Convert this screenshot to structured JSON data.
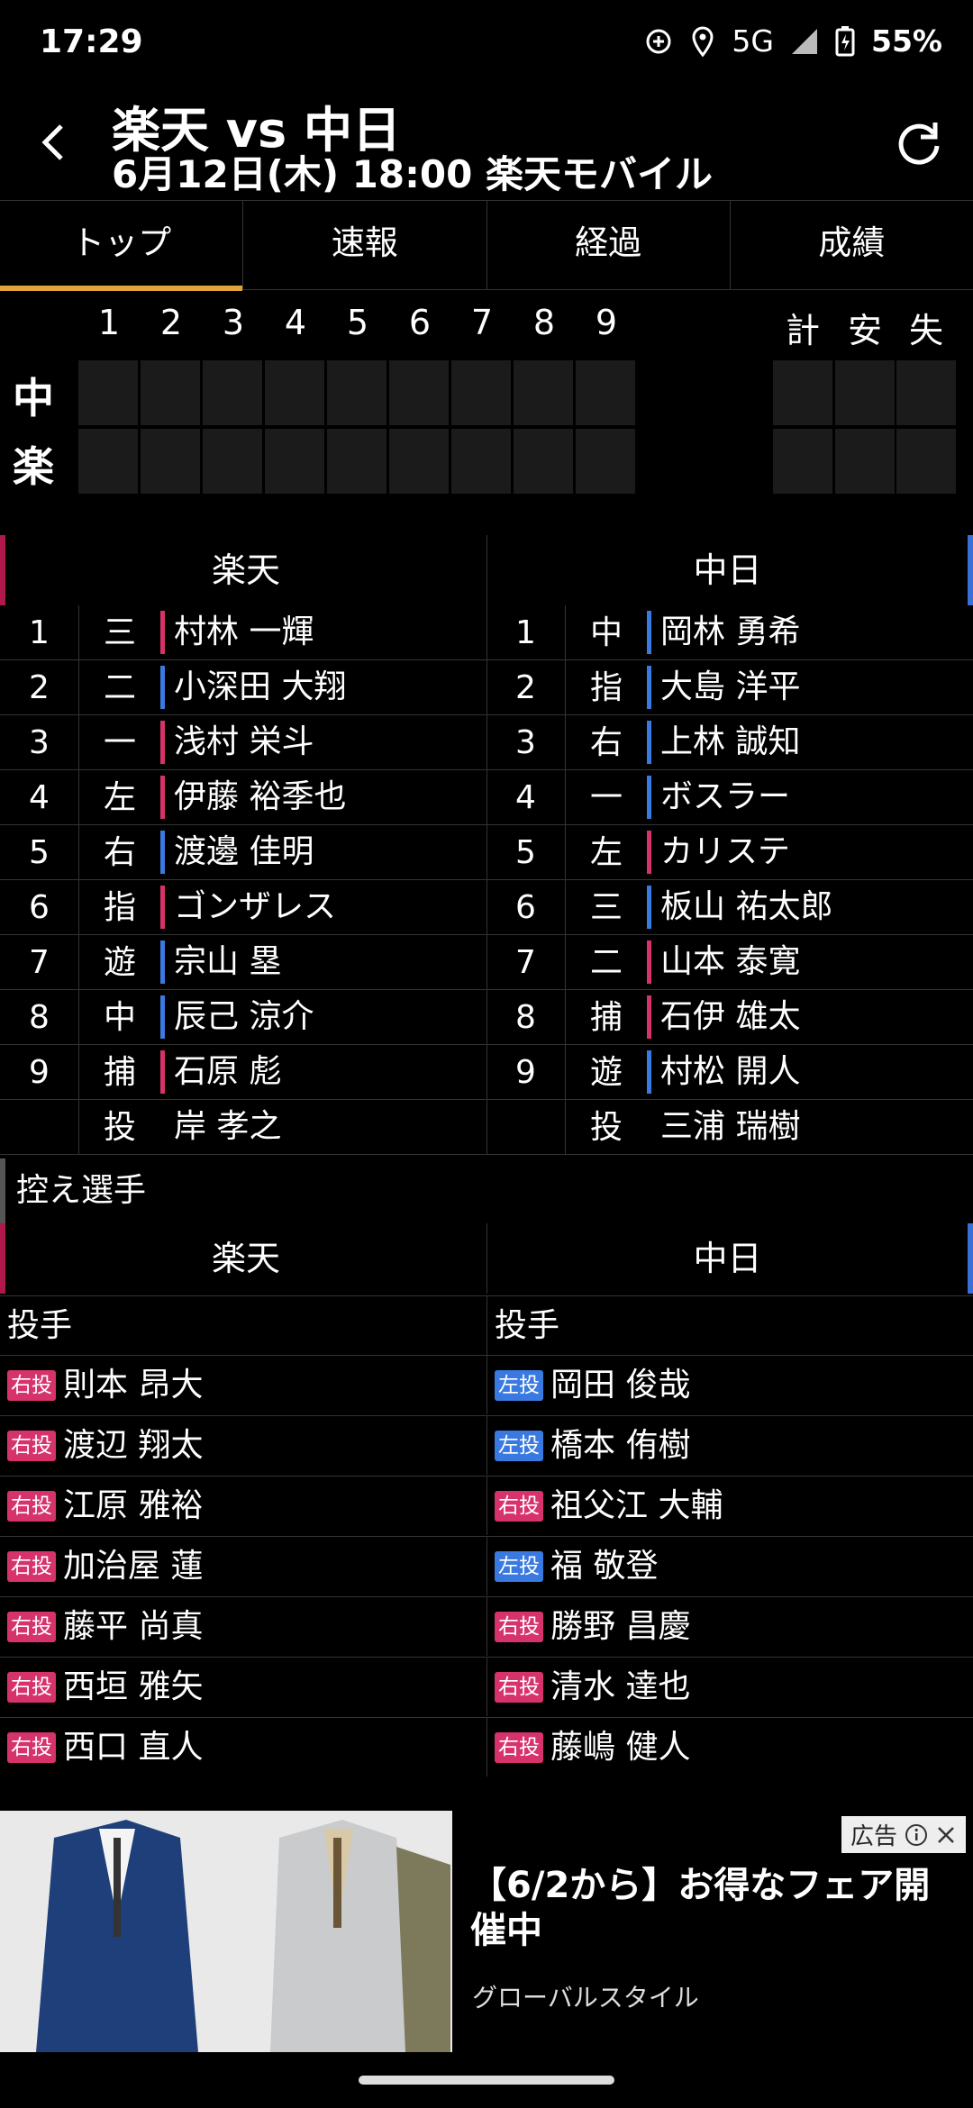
{
  "status": {
    "time": "17:29",
    "network": "5G",
    "battery": "55%"
  },
  "header": {
    "title": "楽天 vs 中日",
    "subtitle": "6月12日(木) 18:00 楽天モバイル"
  },
  "tabs": [
    "トップ",
    "速報",
    "経過",
    "成績"
  ],
  "scoreboard": {
    "innings": [
      "1",
      "2",
      "3",
      "4",
      "5",
      "6",
      "7",
      "8",
      "9"
    ],
    "totals": [
      "計",
      "安",
      "失"
    ],
    "teams": [
      "中",
      "楽"
    ]
  },
  "lineup": {
    "left_team": "楽天",
    "right_team": "中日",
    "rows": [
      {
        "n": "1",
        "lp": "三",
        "ln": "村林 一輝",
        "lc": "red",
        "rp": "中",
        "rn": "岡林 勇希",
        "rc": "blue"
      },
      {
        "n": "2",
        "lp": "二",
        "ln": "小深田 大翔",
        "lc": "blue",
        "rp": "指",
        "rn": "大島 洋平",
        "rc": "blue"
      },
      {
        "n": "3",
        "lp": "一",
        "ln": "浅村 栄斗",
        "lc": "red",
        "rp": "右",
        "rn": "上林 誠知",
        "rc": "blue"
      },
      {
        "n": "4",
        "lp": "左",
        "ln": "伊藤 裕季也",
        "lc": "red",
        "rp": "一",
        "rn": "ボスラー",
        "rc": "blue"
      },
      {
        "n": "5",
        "lp": "右",
        "ln": "渡邊 佳明",
        "lc": "blue",
        "rp": "左",
        "rn": "カリステ",
        "rc": "red"
      },
      {
        "n": "6",
        "lp": "指",
        "ln": "ゴンザレス",
        "lc": "red",
        "rp": "三",
        "rn": "板山 祐太郎",
        "rc": "blue"
      },
      {
        "n": "7",
        "lp": "遊",
        "ln": "宗山 塁",
        "lc": "blue",
        "rp": "二",
        "rn": "山本 泰寛",
        "rc": "red"
      },
      {
        "n": "8",
        "lp": "中",
        "ln": "辰己 涼介",
        "lc": "blue",
        "rp": "捕",
        "rn": "石伊 雄太",
        "rc": "red"
      },
      {
        "n": "9",
        "lp": "捕",
        "ln": "石原 彪",
        "lc": "red",
        "rp": "遊",
        "rn": "村松 開人",
        "rc": "blue"
      },
      {
        "n": "",
        "lp": "投",
        "ln": "岸 孝之",
        "lc": "none",
        "rp": "投",
        "rn": "三浦 瑞樹",
        "rc": "none"
      }
    ]
  },
  "bench": {
    "section_title": "控え選手",
    "left_team": "楽天",
    "right_team": "中日",
    "sub_label": "投手",
    "left": [
      {
        "h": "右投",
        "c": "r",
        "name": "則本 昂大"
      },
      {
        "h": "右投",
        "c": "r",
        "name": "渡辺 翔太"
      },
      {
        "h": "右投",
        "c": "r",
        "name": "江原 雅裕"
      },
      {
        "h": "右投",
        "c": "r",
        "name": "加治屋 蓮"
      },
      {
        "h": "右投",
        "c": "r",
        "name": "藤平 尚真"
      },
      {
        "h": "右投",
        "c": "r",
        "name": "西垣 雅矢"
      },
      {
        "h": "右投",
        "c": "r",
        "name": "西口 直人"
      }
    ],
    "right": [
      {
        "h": "左投",
        "c": "l",
        "name": "岡田 俊哉"
      },
      {
        "h": "左投",
        "c": "l",
        "name": "橋本 侑樹"
      },
      {
        "h": "右投",
        "c": "r",
        "name": "祖父江 大輔"
      },
      {
        "h": "左投",
        "c": "l",
        "name": "福 敬登"
      },
      {
        "h": "右投",
        "c": "r",
        "name": "勝野 昌慶"
      },
      {
        "h": "右投",
        "c": "r",
        "name": "清水 達也"
      },
      {
        "h": "右投",
        "c": "r",
        "name": "藤嶋 健人"
      }
    ]
  },
  "ad": {
    "label": "広告",
    "title": "【6/2から】お得なフェア開催中",
    "sponsor": "グローバルスタイル"
  }
}
